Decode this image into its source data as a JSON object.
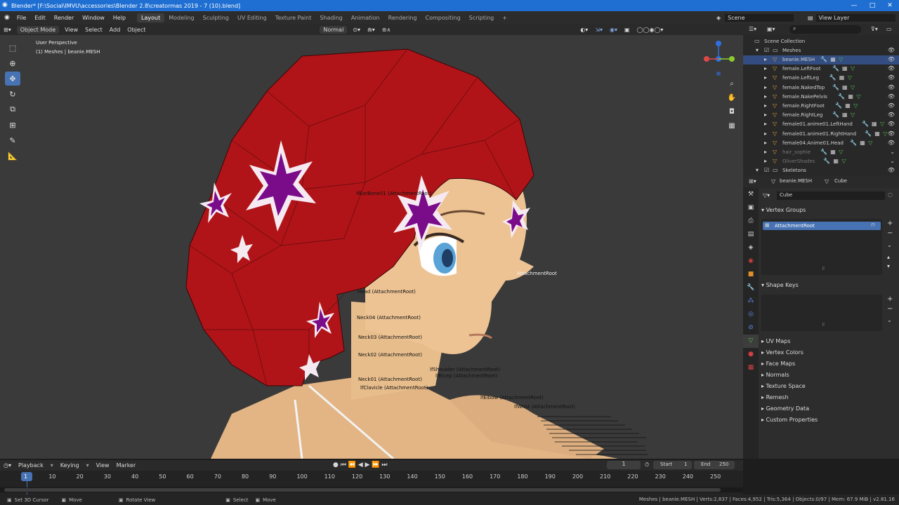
{
  "window": {
    "title": "Blender* [F:\\Social\\IMVU\\accessories\\Blender 2.8\\creatormas 2019 - 7 (10).blend]"
  },
  "menu": [
    "File",
    "Edit",
    "Render",
    "Window",
    "Help"
  ],
  "workspaces": [
    "Layout",
    "Modeling",
    "Sculpting",
    "UV Editing",
    "Texture Paint",
    "Shading",
    "Animation",
    "Rendering",
    "Compositing",
    "Scripting"
  ],
  "active_workspace": "Layout",
  "scene": {
    "label": "Scene",
    "view_layer": "View Layer"
  },
  "viewport_header": {
    "mode": "Object Mode",
    "menus": [
      "View",
      "Select",
      "Add",
      "Object"
    ],
    "orientation": "Normal"
  },
  "viewport_info": {
    "perspective": "User Perspective",
    "selection": "(1) Meshes | beanie.MESH"
  },
  "bones": [
    {
      "text": "lfEarBone01 (AttachmentRoot)"
    },
    {
      "text": "AttachmentRoot"
    },
    {
      "text": "Head (AttachmentRoot)"
    },
    {
      "text": "Neck04 (AttachmentRoot)"
    },
    {
      "text": "Neck03 (AttachmentRoot)"
    },
    {
      "text": "Neck02 (AttachmentRoot)"
    },
    {
      "text": "lfShoulder (AttachmentRoot)"
    },
    {
      "text": "lfBicep (AttachmentRoot)"
    },
    {
      "text": "Neck01 (AttachmentRoot)"
    },
    {
      "text": "lfClavicle (AttachmentRoot)"
    },
    {
      "text": "lfElbow (AttachmentRoot)"
    },
    {
      "text": "lfWrist (AttachmentRoot)"
    }
  ],
  "outliner": {
    "collection": "Scene Collection",
    "meshes_label": "Meshes",
    "items": [
      "beanie.MESH",
      "female.LeftFoot",
      "female.LeftLeg",
      "female.NakedTop",
      "female.NakePelvis",
      "female.RightFoot",
      "female.RightLeg",
      "female01.anime01.LeftHand",
      "female01.anime01.RightHand",
      "female04.Anime01.Head",
      "hair_sophie",
      "OliverShades"
    ],
    "skeletons_label": "Skeletons"
  },
  "properties": {
    "object_name": "beanie.MESH",
    "data_name": "Cube",
    "mesh_field": "Cube",
    "vertex_groups_label": "Vertex Groups",
    "vertex_group_item": "AttachmentRoot",
    "shape_keys_label": "Shape Keys",
    "sections": [
      "UV Maps",
      "Vertex Colors",
      "Face Maps",
      "Normals",
      "Texture Space",
      "Remesh",
      "Geometry Data",
      "Custom Properties"
    ]
  },
  "timeline": {
    "menus": [
      "Playback",
      "Keying",
      "View",
      "Marker"
    ],
    "current_frame": "1",
    "start_label": "Start",
    "start": "1",
    "end_label": "End",
    "end": "250",
    "ticks": [
      "1",
      "10",
      "20",
      "30",
      "40",
      "50",
      "60",
      "70",
      "80",
      "90",
      "100",
      "110",
      "120",
      "130",
      "140",
      "150",
      "160",
      "170",
      "180",
      "190",
      "200",
      "210",
      "220",
      "230",
      "240",
      "250"
    ]
  },
  "statusbar": {
    "left": [
      "Set 3D Cursor",
      "Move",
      "Rotate View",
      "Select",
      "Move"
    ],
    "stats": "Meshes | beanie.MESH | Verts:2,837 | Faces:4,952 | Tris:5,364 | Objects:0/97 | Mem: 67.9 MiB | v2.81.16"
  },
  "colors": {
    "accent": "#4772b3",
    "titlebar": "#1f6fd2",
    "beanie": "#b01418",
    "skin": "#e8bd8c"
  },
  "icons": [
    "blender-logo-icon",
    "select-box-icon",
    "cursor-icon",
    "move-icon",
    "rotate-icon",
    "scale-icon",
    "transform-icon",
    "annotate-icon",
    "measure-icon",
    "eye-icon",
    "zoom-icon",
    "hand-icon",
    "camera-icon",
    "grid-icon"
  ]
}
